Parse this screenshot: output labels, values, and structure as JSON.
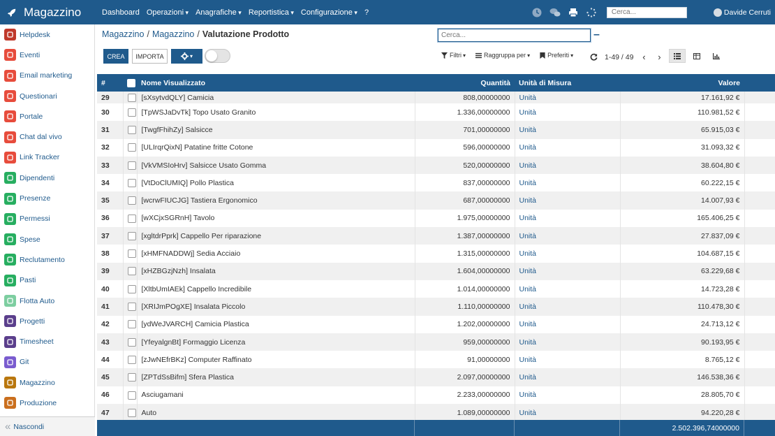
{
  "navbar": {
    "brand": "Magazzino",
    "menu": [
      {
        "label": "Dashboard",
        "dropdown": false
      },
      {
        "label": "Operazioni",
        "dropdown": true
      },
      {
        "label": "Anagrafiche",
        "dropdown": true
      },
      {
        "label": "Reportistica",
        "dropdown": true
      },
      {
        "label": "Configurazione",
        "dropdown": true
      },
      {
        "label": "?",
        "dropdown": false
      }
    ],
    "search_placeholder": "Cerca...",
    "user_name": "Davide Cerruti",
    "icons": [
      "clock-icon",
      "chat-icon",
      "print-icon",
      "spinner-icon"
    ]
  },
  "sidebar": {
    "items": [
      {
        "label": "Helpdesk",
        "icon": "helpdesk-icon",
        "color": "#c0392b"
      },
      {
        "label": "Eventi",
        "icon": "ticket-icon",
        "color": "#e74c3c"
      },
      {
        "label": "Email marketing",
        "icon": "paper-plane-icon",
        "color": "#e74c3c"
      },
      {
        "label": "Questionari",
        "icon": "clipboard-icon",
        "color": "#e74c3c"
      },
      {
        "label": "Portale",
        "icon": "globe-icon",
        "color": "#e74c3c"
      },
      {
        "label": "Chat dal vivo",
        "icon": "chat-bubbles-icon",
        "color": "#e74c3c"
      },
      {
        "label": "Link Tracker",
        "icon": "link-icon",
        "color": "#e74c3c"
      },
      {
        "label": "Dipendenti",
        "icon": "employees-icon",
        "color": "#27ae60"
      },
      {
        "label": "Presenze",
        "icon": "attendance-icon",
        "color": "#27ae60"
      },
      {
        "label": "Permessi",
        "icon": "leave-icon",
        "color": "#27ae60"
      },
      {
        "label": "Spese",
        "icon": "dollar-icon",
        "color": "#27ae60"
      },
      {
        "label": "Reclutamento",
        "icon": "recruit-icon",
        "color": "#27ae60"
      },
      {
        "label": "Pasti",
        "icon": "cutlery-icon",
        "color": "#27ae60"
      },
      {
        "label": "Flotta Auto",
        "icon": "car-icon",
        "color": "#7dcea0"
      },
      {
        "label": "Progetti",
        "icon": "puzzle-icon",
        "color": "#5b3f8c"
      },
      {
        "label": "Timesheet",
        "icon": "timesheet-icon",
        "color": "#5b3f8c"
      },
      {
        "label": "Git",
        "icon": "git-icon",
        "color": "#7a5ccf"
      },
      {
        "label": "Magazzino",
        "icon": "box-icon",
        "color": "#b9770e"
      },
      {
        "label": "Produzione",
        "icon": "wrench-icon",
        "color": "#ca6f1e"
      }
    ],
    "footer_label": "Nascondi"
  },
  "breadcrumb": {
    "items": [
      "Magazzino",
      "Magazzino"
    ],
    "current": "Valutazione Prodotto"
  },
  "control_panel": {
    "search_placeholder": "Cerca...",
    "crea_label": "CREA",
    "importa_label": "IMPORTA",
    "filters_label": "Filtri",
    "groupby_label": "Raggruppa per",
    "favorites_label": "Preferiti",
    "pager": "1-49 / 49"
  },
  "table": {
    "headers": {
      "index": "#",
      "name": "Nome Visualizzato",
      "qty": "Quantità",
      "uom": "Unità di Misura",
      "value": "Valore"
    },
    "rows": [
      {
        "i": "29",
        "name": "[sXsytvdQLY] Camicia",
        "qty": "808,00000000",
        "uom": "Unità",
        "value": "17.161,92 €"
      },
      {
        "i": "30",
        "name": "[TpWSJaDvTk] Topo Usato Granito",
        "qty": "1.336,00000000",
        "uom": "Unità",
        "value": "110.981,52 €"
      },
      {
        "i": "31",
        "name": "[TwgfFhihZy] Salsicce",
        "qty": "701,00000000",
        "uom": "Unità",
        "value": "65.915,03 €"
      },
      {
        "i": "32",
        "name": "[ULIrqrQixN] Patatine fritte Cotone",
        "qty": "596,00000000",
        "uom": "Unità",
        "value": "31.093,32 €"
      },
      {
        "i": "33",
        "name": "[VkVMSIoHrv] Salsicce Usato Gomma",
        "qty": "520,00000000",
        "uom": "Unità",
        "value": "38.604,80 €"
      },
      {
        "i": "34",
        "name": "[VtDoClUMIQ] Pollo Plastica",
        "qty": "837,00000000",
        "uom": "Unità",
        "value": "60.222,15 €"
      },
      {
        "i": "35",
        "name": "[wcrwFIUCJG] Tastiera Ergonomico",
        "qty": "687,00000000",
        "uom": "Unità",
        "value": "14.007,93 €"
      },
      {
        "i": "36",
        "name": "[wXCjxSGRnH] Tavolo",
        "qty": "1.975,00000000",
        "uom": "Unità",
        "value": "165.406,25 €"
      },
      {
        "i": "37",
        "name": "[xgltdrPprk] Cappello Per riparazione",
        "qty": "1.387,00000000",
        "uom": "Unità",
        "value": "27.837,09 €"
      },
      {
        "i": "38",
        "name": "[xHMFNADDWj] Sedia Acciaio",
        "qty": "1.315,00000000",
        "uom": "Unità",
        "value": "104.687,15 €"
      },
      {
        "i": "39",
        "name": "[xHZBGzjNzh] Insalata",
        "qty": "1.604,00000000",
        "uom": "Unità",
        "value": "63.229,68 €"
      },
      {
        "i": "40",
        "name": "[XltbUmIAEk] Cappello Incredibile",
        "qty": "1.014,00000000",
        "uom": "Unità",
        "value": "14.723,28 €"
      },
      {
        "i": "41",
        "name": "[XRIJmPOgXE] Insalata Piccolo",
        "qty": "1.110,00000000",
        "uom": "Unità",
        "value": "110.478,30 €"
      },
      {
        "i": "42",
        "name": "[ydWeJVARCH] Camicia Plastica",
        "qty": "1.202,00000000",
        "uom": "Unità",
        "value": "24.713,12 €"
      },
      {
        "i": "43",
        "name": "[YfeyalgnBt] Formaggio Licenza",
        "qty": "959,00000000",
        "uom": "Unità",
        "value": "90.193,95 €"
      },
      {
        "i": "44",
        "name": "[zJwNEfrBKz] Computer Raffinato",
        "qty": "91,00000000",
        "uom": "Unità",
        "value": "8.765,12 €"
      },
      {
        "i": "45",
        "name": "[ZPTdSsBifm] Sfera Plastica",
        "qty": "2.097,00000000",
        "uom": "Unità",
        "value": "146.538,36 €"
      },
      {
        "i": "46",
        "name": "Asciugamani",
        "qty": "2.233,00000000",
        "uom": "Unità",
        "value": "28.805,70 €"
      },
      {
        "i": "47",
        "name": "Auto",
        "qty": "1.089,00000000",
        "uom": "Unità",
        "value": "94.220,28 €"
      }
    ],
    "footer_total": "2.502.396,74000000"
  },
  "colors": {
    "primary": "#1f5a8c",
    "row_alt": "#f0f0f0"
  }
}
